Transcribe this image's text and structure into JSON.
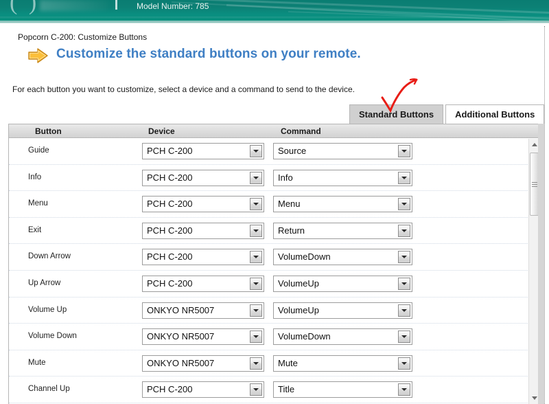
{
  "banner": {
    "model_number_label": "Model Number: 785",
    "logo_glyph": "( )",
    "bg_color": "#0a8275"
  },
  "heading": {
    "breadcrumb": "Popcorn C-200: Customize Buttons",
    "title": "Customize the standard buttons on your remote.",
    "title_color": "#3f7fc4",
    "arrow_icon": "right-arrow-icon",
    "arrow_color": "#f5a623"
  },
  "intro": {
    "text": "For each button you want to customize, select a device and a command to send to the device."
  },
  "tabs": [
    {
      "label": "Standard Buttons",
      "selected": true
    },
    {
      "label": "Additional Buttons",
      "selected": false
    }
  ],
  "annotation": {
    "type": "red-check-arrow",
    "color": "#e81d16",
    "points_at": "Standard Buttons"
  },
  "table": {
    "columns": [
      "Button",
      "Device",
      "Command"
    ],
    "rows": [
      {
        "button": "Guide",
        "device": "PCH C-200",
        "command": "Source"
      },
      {
        "button": "Info",
        "device": "PCH C-200",
        "command": "Info"
      },
      {
        "button": "Menu",
        "device": "PCH C-200",
        "command": "Menu"
      },
      {
        "button": "Exit",
        "device": "PCH C-200",
        "command": "Return"
      },
      {
        "button": "Down Arrow",
        "device": "PCH C-200",
        "command": "VolumeDown"
      },
      {
        "button": "Up Arrow",
        "device": "PCH C-200",
        "command": "VolumeUp"
      },
      {
        "button": "Volume Up",
        "device": "ONKYO NR5007",
        "command": "VolumeUp"
      },
      {
        "button": "Volume Down",
        "device": "ONKYO NR5007",
        "command": "VolumeDown"
      },
      {
        "button": "Mute",
        "device": "ONKYO NR5007",
        "command": "Mute"
      },
      {
        "button": "Channel Up",
        "device": "PCH C-200",
        "command": "Title"
      }
    ]
  },
  "scrollbar": {
    "up_icon": "triangle-up-icon",
    "down_icon": "triangle-down-icon",
    "thumb_position": "top"
  }
}
